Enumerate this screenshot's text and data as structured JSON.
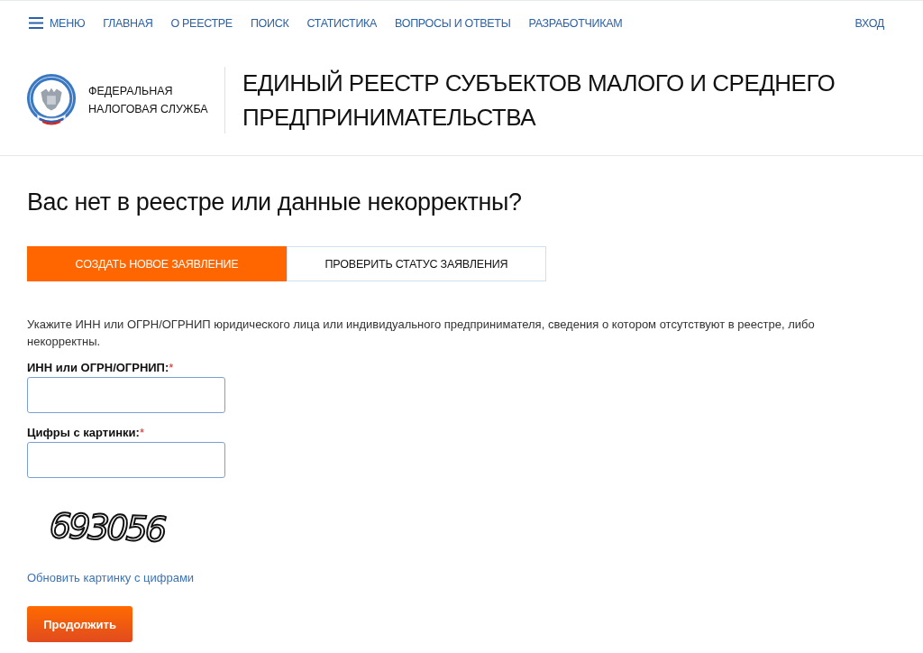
{
  "nav": {
    "menu": "МЕНЮ",
    "items": [
      {
        "label": "ГЛАВНАЯ"
      },
      {
        "label": "О РЕЕСТРЕ"
      },
      {
        "label": "ПОИСК"
      },
      {
        "label": "СТАТИСТИКА"
      },
      {
        "label": "ВОПРОСЫ И ОТВЕТЫ"
      },
      {
        "label": "РАЗРАБОТЧИКАМ"
      }
    ],
    "login": "ВХОД"
  },
  "header": {
    "org_name": "ФЕДЕРАЛЬНАЯ НАЛОГОВАЯ СЛУЖБА",
    "title": "ЕДИНЫЙ РЕЕСТР СУБЪЕКТОВ МАЛОГО И СРЕДНЕГО ПРЕДПРИНИМАТЕЛЬСТВА"
  },
  "heading": "Вас нет в реестре или данные некорректны?",
  "tabs": [
    {
      "label": "СОЗДАТЬ НОВОЕ ЗАЯВЛЕНИЕ",
      "selected": true
    },
    {
      "label": "ПРОВЕРИТЬ СТАТУС ЗАЯВЛЕНИЯ",
      "selected": false
    }
  ],
  "form": {
    "instruction": "Укажите ИНН или ОГРН/ОГРНИП юридического лица или индивидуального предпринимателя, сведения о котором отсутствуют в реестре, либо некорректны.",
    "fields": [
      {
        "label": "ИНН или ОГРН/ОГРНИП:",
        "required_mark": "*"
      },
      {
        "label": "Цифры с картинки:",
        "required_mark": "*"
      }
    ],
    "captcha": {
      "digits": "693056"
    },
    "refresh_link": "Обновить картинку с цифрами",
    "submit": "Продолжить"
  }
}
